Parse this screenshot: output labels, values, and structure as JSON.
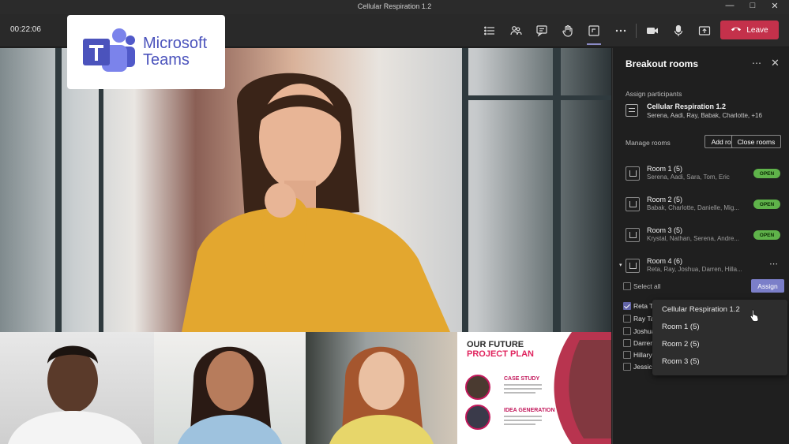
{
  "window": {
    "title": "Cellular Respiration 1.2"
  },
  "toolbar": {
    "timer": "00:22:06",
    "leave_label": "Leave",
    "icons": [
      "list-icon",
      "people-icon",
      "chat-icon",
      "raise-hand-icon",
      "breakout-rooms-icon",
      "more-icon",
      "camera-icon",
      "microphone-icon",
      "share-icon"
    ]
  },
  "logo": {
    "text_line1": "Microsoft",
    "text_line2": "Teams"
  },
  "slide": {
    "title_line1": "OUR FUTURE",
    "title_line2": "PROJECT PLAN",
    "heading1": "CASE STUDY",
    "heading2": "IDEA GENERATION"
  },
  "panel": {
    "title": "Breakout rooms",
    "assign_participants_label": "Assign participants",
    "meeting": {
      "name": "Cellular Respiration 1.2",
      "participants": "Serena, Aadi, Ray, Babak, Charlotte, +16"
    },
    "manage_rooms_label": "Manage rooms",
    "add_room_label": "Add room",
    "close_rooms_label": "Close rooms",
    "rooms": [
      {
        "name": "Room 1 (5)",
        "members": "Serena, Aadi, Sara, Tom, Eric",
        "status": "OPEN"
      },
      {
        "name": "Room 2 (5)",
        "members": "Babak, Charlotte, Danielle, Mig...",
        "status": "OPEN"
      },
      {
        "name": "Room 3 (5)",
        "members": "Krystal, Nathan, Serena, Andre...",
        "status": "OPEN"
      },
      {
        "name": "Room 4 (6)",
        "members": "Reta, Ray, Joshua, Darren, Hilla...",
        "status": ""
      }
    ],
    "select_all_label": "Select all",
    "assign_label": "Assign",
    "participants": [
      {
        "name": "Reta Ta",
        "checked": true
      },
      {
        "name": "Ray Tar",
        "checked": false
      },
      {
        "name": "Joshua",
        "checked": false
      },
      {
        "name": "Darren",
        "checked": false
      },
      {
        "name": "Hillary",
        "checked": false
      },
      {
        "name": "Jessica",
        "checked": false
      }
    ]
  },
  "dropdown": {
    "options": [
      "Cellular Respiration 1.2",
      "Room 1 (5)",
      "Room 2 (5)",
      "Room 3 (5)"
    ]
  },
  "colors": {
    "accent": "#6264a7",
    "leave": "#c4314b",
    "open_badge": "#5fb34a",
    "panel_bg": "#1f1f1f"
  }
}
